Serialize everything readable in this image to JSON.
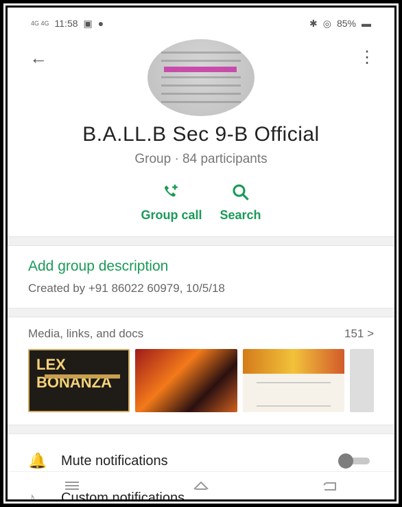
{
  "status_bar": {
    "network_left": "4G 4G",
    "time": "11:58",
    "right_text": "85%"
  },
  "group": {
    "title": "B.A.LL.B Sec 9-B Official",
    "subtitle": "Group · 84 participants"
  },
  "actions": {
    "call_label": "Group call",
    "search_label": "Search"
  },
  "description": {
    "add_label": "Add group description",
    "created": "Created by +91 86022 60979, 10/5/18"
  },
  "media": {
    "title": "Media, links, and docs",
    "count": "151 >",
    "thumb1_banner": "LEX BONANZA"
  },
  "settings": {
    "mute_label": "Mute notifications",
    "custom_label": "Custom notifications"
  },
  "colors": {
    "accent": "#1a9a57"
  }
}
